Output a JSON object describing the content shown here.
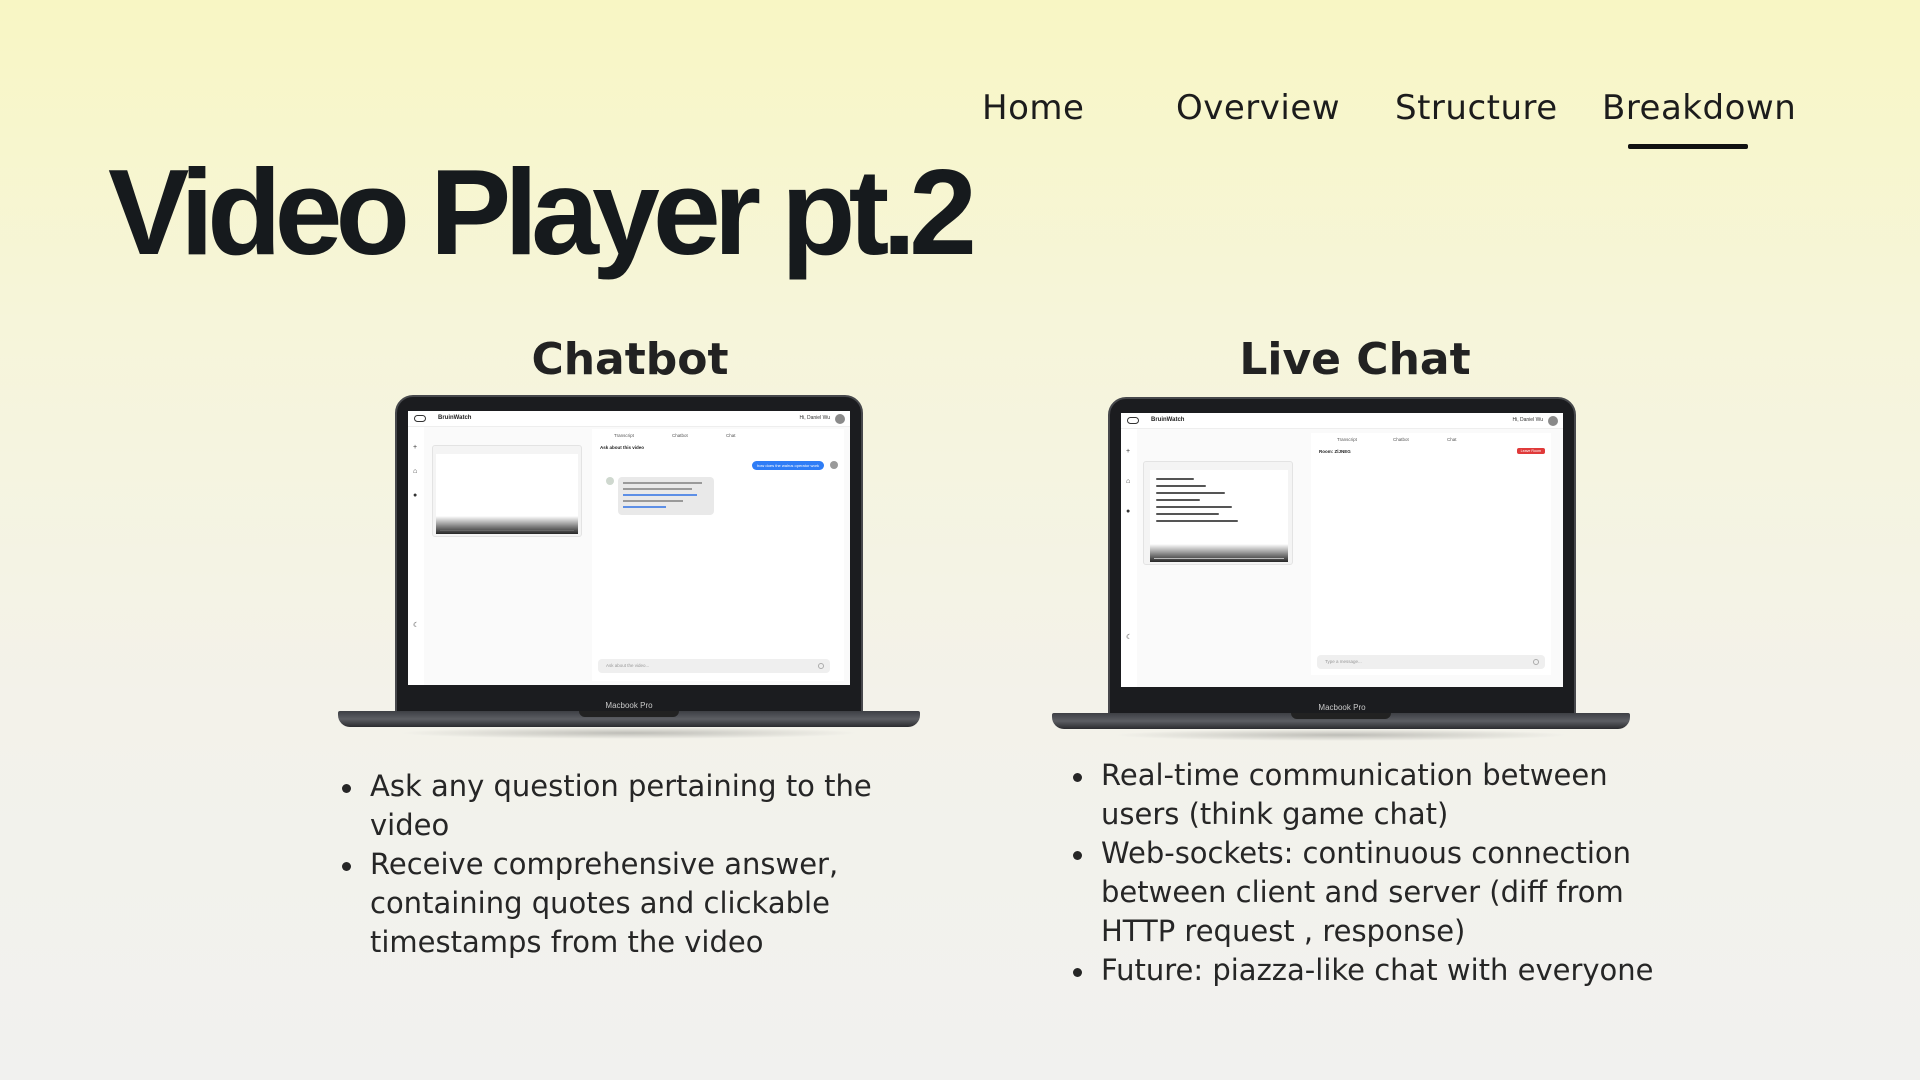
{
  "nav": {
    "items": [
      {
        "label": "Home"
      },
      {
        "label": "Overview"
      },
      {
        "label": "Structure"
      },
      {
        "label": "Breakdown"
      }
    ],
    "active": "Breakdown"
  },
  "page": {
    "title": "Video Player pt.2"
  },
  "chatbot": {
    "heading": "Chatbot",
    "device_label": "Macbook Pro",
    "app": {
      "name": "BruinWatch",
      "user": "Hi, Daniel Wu",
      "tabs": [
        "Transcript",
        "Chatbot",
        "Chat"
      ],
      "panel_title": "Ask about this video",
      "user_message": "how does the walrus operator work",
      "input_placeholder": "Ask about the video..."
    },
    "bullets": [
      "Ask any question pertaining to the video",
      "Receive comprehensive answer, containing quotes and clickable timestamps from the video"
    ]
  },
  "livechat": {
    "heading": "Live Chat",
    "device_label": "Macbook Pro",
    "app": {
      "name": "BruinWatch",
      "user": "Hi, Daniel Wu",
      "tabs": [
        "Transcript",
        "Chatbot",
        "Chat"
      ],
      "room": "Room: ZlJNEG",
      "leave_label": "Leave Room",
      "input_placeholder": "Type a message..."
    },
    "bullets": [
      "Real-time communication between users (think game chat)",
      "Web-sockets: continuous connection between client and server (diff from HTTP request , response)",
      "Future: piazza-like chat with everyone"
    ]
  },
  "colors": {
    "accent_blue": "#2f7df6",
    "leave_red": "#e03a3a",
    "title": "#161a1d"
  }
}
